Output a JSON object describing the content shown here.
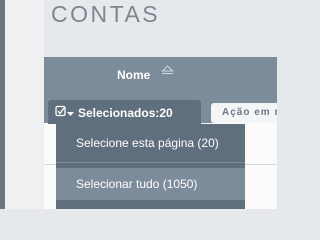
{
  "page": {
    "title": "CONTAS"
  },
  "table": {
    "column_name_label": "Nome"
  },
  "toolbar": {
    "select_label": "Selecionados:20",
    "action_label": "Ação em massa"
  },
  "dropdown": {
    "items": [
      {
        "label": "Selecione esta página (20)"
      },
      {
        "label": "Selecionar tudo (1050)"
      }
    ]
  },
  "icons": {
    "sort": "sort-updown-icon",
    "checkbox": "checkbox-icon",
    "caret": "caret-down-icon"
  },
  "colors": {
    "header": "#7d8c9a",
    "dropdown": "#606f7d",
    "title": "#7d8792"
  }
}
